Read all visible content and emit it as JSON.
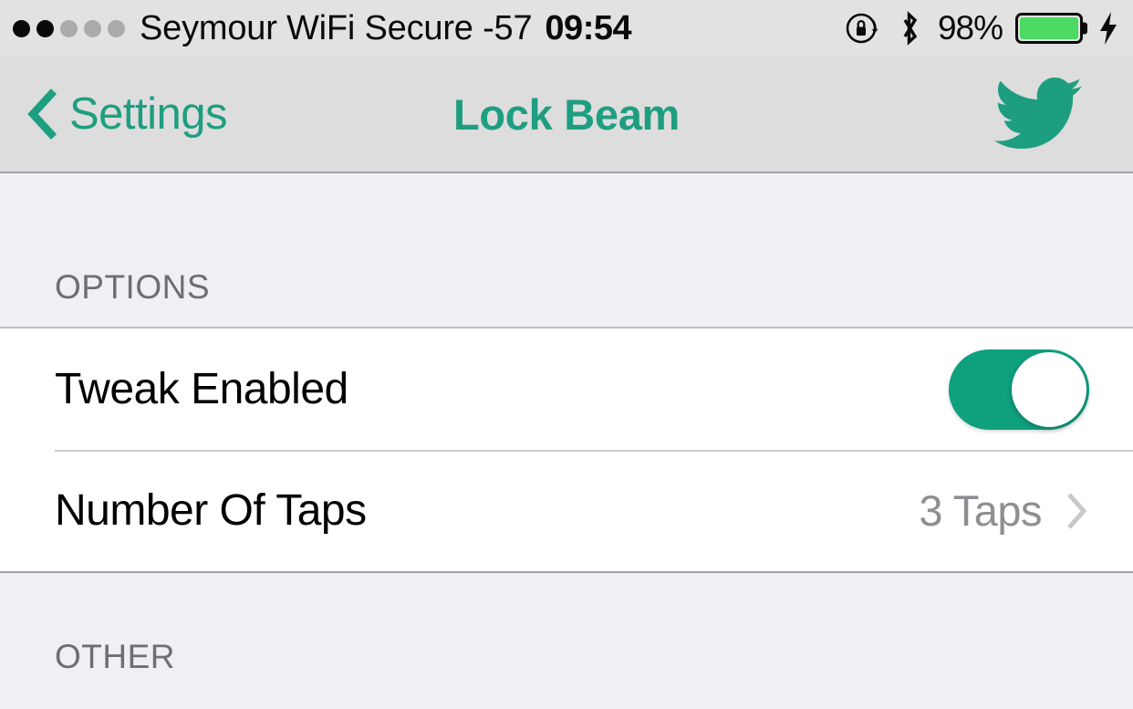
{
  "status_bar": {
    "carrier": "Seymour WiFi Secure -57",
    "time": "09:54",
    "battery_percent": "98%",
    "signal_dots_total": 5,
    "signal_dots_filled": 2,
    "battery_level": 100,
    "battery_color": "#4CD964",
    "icons": {
      "rotation_lock": "rotation-lock-icon",
      "bluetooth": "bluetooth-icon",
      "charging": "charging-bolt-icon"
    }
  },
  "nav_bar": {
    "back_label": "Settings",
    "title": "Lock Beam",
    "twitter_icon": "twitter-bird-icon",
    "accent_color": "#1E9E80"
  },
  "sections": [
    {
      "header": "OPTIONS",
      "rows": [
        {
          "label": "Tweak Enabled",
          "type": "switch",
          "value": "on",
          "switch_on_color": "#0FA07E"
        },
        {
          "label": "Number Of Taps",
          "type": "disclosure",
          "value": "3 Taps",
          "chevron": "chevron-right-icon"
        }
      ]
    },
    {
      "header": "OTHER",
      "rows": []
    }
  ]
}
